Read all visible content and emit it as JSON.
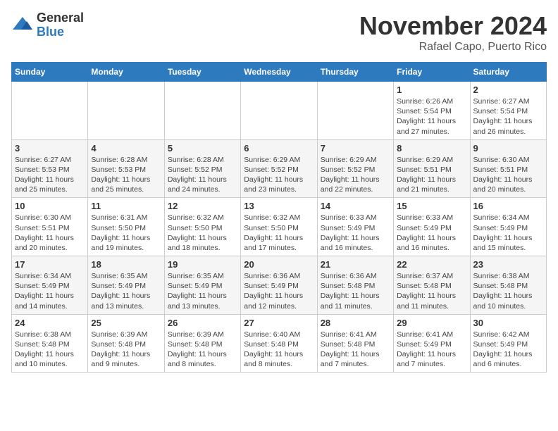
{
  "logo": {
    "general": "General",
    "blue": "Blue"
  },
  "title": {
    "month": "November 2024",
    "location": "Rafael Capo, Puerto Rico"
  },
  "weekdays": [
    "Sunday",
    "Monday",
    "Tuesday",
    "Wednesday",
    "Thursday",
    "Friday",
    "Saturday"
  ],
  "weeks": [
    [
      {
        "day": "",
        "info": ""
      },
      {
        "day": "",
        "info": ""
      },
      {
        "day": "",
        "info": ""
      },
      {
        "day": "",
        "info": ""
      },
      {
        "day": "",
        "info": ""
      },
      {
        "day": "1",
        "info": "Sunrise: 6:26 AM\nSunset: 5:54 PM\nDaylight: 11 hours and 27 minutes."
      },
      {
        "day": "2",
        "info": "Sunrise: 6:27 AM\nSunset: 5:54 PM\nDaylight: 11 hours and 26 minutes."
      }
    ],
    [
      {
        "day": "3",
        "info": "Sunrise: 6:27 AM\nSunset: 5:53 PM\nDaylight: 11 hours and 25 minutes."
      },
      {
        "day": "4",
        "info": "Sunrise: 6:28 AM\nSunset: 5:53 PM\nDaylight: 11 hours and 25 minutes."
      },
      {
        "day": "5",
        "info": "Sunrise: 6:28 AM\nSunset: 5:52 PM\nDaylight: 11 hours and 24 minutes."
      },
      {
        "day": "6",
        "info": "Sunrise: 6:29 AM\nSunset: 5:52 PM\nDaylight: 11 hours and 23 minutes."
      },
      {
        "day": "7",
        "info": "Sunrise: 6:29 AM\nSunset: 5:52 PM\nDaylight: 11 hours and 22 minutes."
      },
      {
        "day": "8",
        "info": "Sunrise: 6:29 AM\nSunset: 5:51 PM\nDaylight: 11 hours and 21 minutes."
      },
      {
        "day": "9",
        "info": "Sunrise: 6:30 AM\nSunset: 5:51 PM\nDaylight: 11 hours and 20 minutes."
      }
    ],
    [
      {
        "day": "10",
        "info": "Sunrise: 6:30 AM\nSunset: 5:51 PM\nDaylight: 11 hours and 20 minutes."
      },
      {
        "day": "11",
        "info": "Sunrise: 6:31 AM\nSunset: 5:50 PM\nDaylight: 11 hours and 19 minutes."
      },
      {
        "day": "12",
        "info": "Sunrise: 6:32 AM\nSunset: 5:50 PM\nDaylight: 11 hours and 18 minutes."
      },
      {
        "day": "13",
        "info": "Sunrise: 6:32 AM\nSunset: 5:50 PM\nDaylight: 11 hours and 17 minutes."
      },
      {
        "day": "14",
        "info": "Sunrise: 6:33 AM\nSunset: 5:49 PM\nDaylight: 11 hours and 16 minutes."
      },
      {
        "day": "15",
        "info": "Sunrise: 6:33 AM\nSunset: 5:49 PM\nDaylight: 11 hours and 16 minutes."
      },
      {
        "day": "16",
        "info": "Sunrise: 6:34 AM\nSunset: 5:49 PM\nDaylight: 11 hours and 15 minutes."
      }
    ],
    [
      {
        "day": "17",
        "info": "Sunrise: 6:34 AM\nSunset: 5:49 PM\nDaylight: 11 hours and 14 minutes."
      },
      {
        "day": "18",
        "info": "Sunrise: 6:35 AM\nSunset: 5:49 PM\nDaylight: 11 hours and 13 minutes."
      },
      {
        "day": "19",
        "info": "Sunrise: 6:35 AM\nSunset: 5:49 PM\nDaylight: 11 hours and 13 minutes."
      },
      {
        "day": "20",
        "info": "Sunrise: 6:36 AM\nSunset: 5:49 PM\nDaylight: 11 hours and 12 minutes."
      },
      {
        "day": "21",
        "info": "Sunrise: 6:36 AM\nSunset: 5:48 PM\nDaylight: 11 hours and 11 minutes."
      },
      {
        "day": "22",
        "info": "Sunrise: 6:37 AM\nSunset: 5:48 PM\nDaylight: 11 hours and 11 minutes."
      },
      {
        "day": "23",
        "info": "Sunrise: 6:38 AM\nSunset: 5:48 PM\nDaylight: 11 hours and 10 minutes."
      }
    ],
    [
      {
        "day": "24",
        "info": "Sunrise: 6:38 AM\nSunset: 5:48 PM\nDaylight: 11 hours and 10 minutes."
      },
      {
        "day": "25",
        "info": "Sunrise: 6:39 AM\nSunset: 5:48 PM\nDaylight: 11 hours and 9 minutes."
      },
      {
        "day": "26",
        "info": "Sunrise: 6:39 AM\nSunset: 5:48 PM\nDaylight: 11 hours and 8 minutes."
      },
      {
        "day": "27",
        "info": "Sunrise: 6:40 AM\nSunset: 5:48 PM\nDaylight: 11 hours and 8 minutes."
      },
      {
        "day": "28",
        "info": "Sunrise: 6:41 AM\nSunset: 5:48 PM\nDaylight: 11 hours and 7 minutes."
      },
      {
        "day": "29",
        "info": "Sunrise: 6:41 AM\nSunset: 5:49 PM\nDaylight: 11 hours and 7 minutes."
      },
      {
        "day": "30",
        "info": "Sunrise: 6:42 AM\nSunset: 5:49 PM\nDaylight: 11 hours and 6 minutes."
      }
    ]
  ]
}
